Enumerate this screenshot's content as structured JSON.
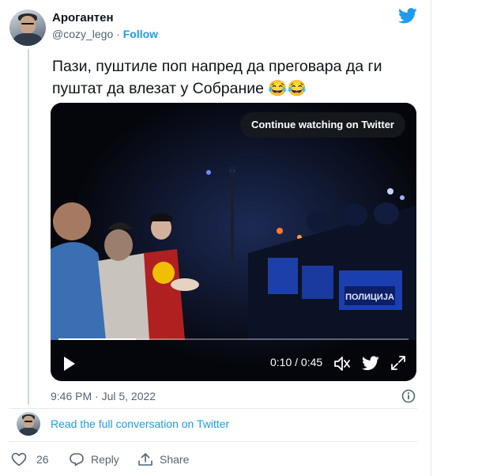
{
  "user": {
    "name": "Арогантен",
    "handle": "@cozy_lego",
    "separator": " · ",
    "follow_label": "Follow"
  },
  "tweet": {
    "text": "Пази, пуштиле поп напред да преговара да ги пуштат да влезат у Собрание 😂😂",
    "timestamp": "9:46 PM · Jul 5, 2022"
  },
  "video": {
    "continue_label": "Continue watching on Twitter",
    "time": "0:10 / 0:45",
    "progress": 0.222,
    "police_label": "ПОЛИЦИЈА"
  },
  "conversation": {
    "read_label": "Read the full conversation on Twitter"
  },
  "actions": {
    "like_count": "26",
    "reply_label": "Reply",
    "share_label": "Share"
  },
  "icons": [
    "twitter-bird-icon",
    "play-icon",
    "volume-icon",
    "twitter-small-icon",
    "expand-icon",
    "info-icon",
    "heart-icon",
    "reply-icon",
    "share-icon"
  ],
  "colors": {
    "brand": "#1d9bf0",
    "text": "#0f1419",
    "muted": "#536471",
    "like": "#e0245e"
  }
}
